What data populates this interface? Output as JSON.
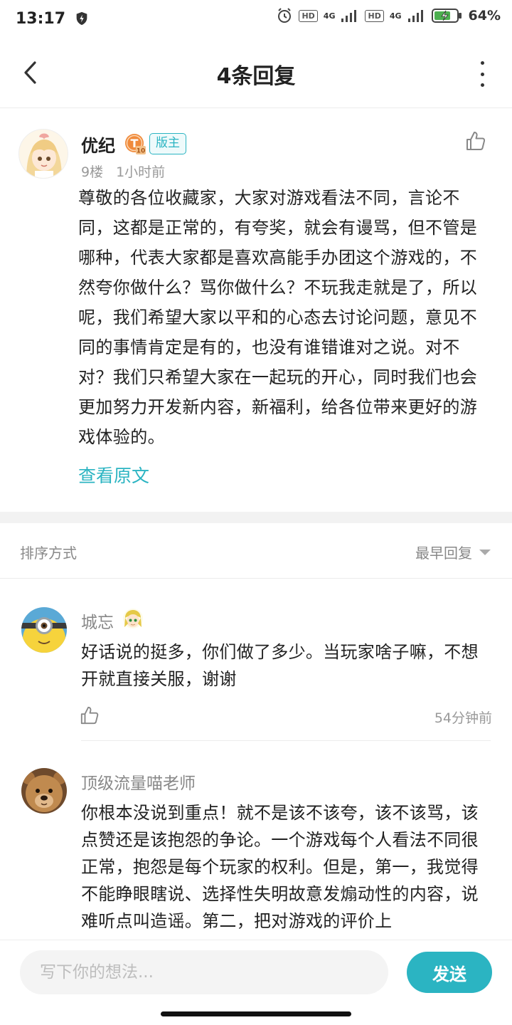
{
  "status_bar": {
    "time": "13:17",
    "hd1": "HD",
    "net1": "4G",
    "hd2": "HD",
    "net2": "4G",
    "battery": "64%",
    "icons": [
      "shield-icon",
      "alarm-icon",
      "signal-icon",
      "battery-icon"
    ]
  },
  "header": {
    "title": "4条回复",
    "back_icon": "chevron-left-icon",
    "more_icon": "more-vertical-icon"
  },
  "post": {
    "author": "优纪",
    "level_badge": "T",
    "level_number": "10",
    "role_badge": "版主",
    "floor": "9楼",
    "time": "1小时前",
    "body": "尊敬的各位收藏家，大家对游戏看法不同，言论不同，这都是正常的，有夸奖，就会有谩骂，但不管是哪种，代表大家都是喜欢高能手办团这个游戏的，不然夸你做什么？骂你做什么？不玩我走就是了，所以呢，我们希望大家以平和的心态去讨论问题，意见不同的事情肯定是有的，也没有谁错谁对之说。对不对？我们只希望大家在一起玩的开心，同时我们也会更加努力开发新内容，新福利，给各位带来更好的游戏体验的。",
    "view_original": "查看原文"
  },
  "sort": {
    "label": "排序方式",
    "selected": "最早回复"
  },
  "replies": [
    {
      "author": "城忘",
      "body": "好话说的挺多，你们做了多少。当玩家啥子嘛，不想开就直接关服，谢谢",
      "time": "54分钟前"
    },
    {
      "author": "顶级流量喵老师",
      "body": "你根本没说到重点！就不是该不该夸，该不该骂，该点赞还是该抱怨的争论。一个游戏每个人看法不同很正常，抱怨是每个玩家的权利。但是，第一，我觉得不能睁眼瞎说、选择性失明故意发煽动性的内容，说难听点叫造谣。第二，把对游戏的评价上"
    }
  ],
  "input": {
    "placeholder": "写下你的想法...",
    "send_label": "发送"
  },
  "colors": {
    "accent": "#2bb4c2",
    "muted_text": "#999999"
  }
}
